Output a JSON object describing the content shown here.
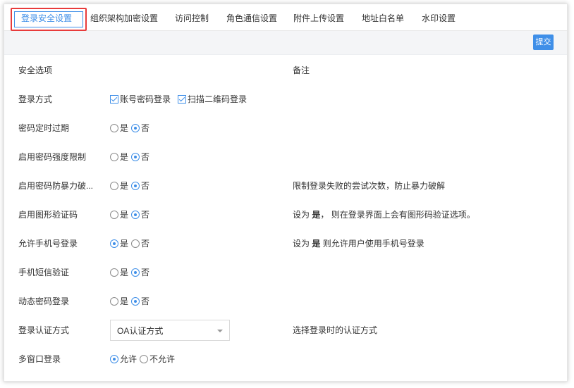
{
  "tabs": [
    {
      "label": "登录安全设置",
      "active": true
    },
    {
      "label": "组织架构加密设置"
    },
    {
      "label": "访问控制"
    },
    {
      "label": "角色通信设置"
    },
    {
      "label": "附件上传设置"
    },
    {
      "label": "地址白名单"
    },
    {
      "label": "水印设置"
    }
  ],
  "toolbar": {
    "submit_label": "提交"
  },
  "header": {
    "options_label": "安全选项",
    "notes_label": "备注"
  },
  "login_methods": {
    "label": "登录方式",
    "options": [
      "账号密码登录",
      "扫描二维码登录"
    ]
  },
  "yes_no": {
    "yes": "是",
    "no": "否"
  },
  "allow_deny": {
    "allow": "允许",
    "deny": "不允许"
  },
  "rows": [
    {
      "label": "密码定时过期",
      "value": "否",
      "note": ""
    },
    {
      "label": "启用密码强度限制",
      "value": "否",
      "note": ""
    },
    {
      "label": "启用密码防暴力破...",
      "value": "否",
      "note": "限制登录失败的尝试次数，防止暴力破解"
    },
    {
      "label": "启用图形验证码",
      "value": "否",
      "note_pre": "设为 ",
      "note_bold": "是",
      "note_post": "， 则在登录界面上会有图形码验证选项。"
    },
    {
      "label": "允许手机号登录",
      "value": "是",
      "note_pre": "设为 ",
      "note_bold": "是",
      "note_post": " 则允许用户使用手机号登录"
    },
    {
      "label": "手机短信验证",
      "value": "否",
      "note": ""
    },
    {
      "label": "动态密码登录",
      "value": "否",
      "note": ""
    }
  ],
  "auth_method": {
    "label": "登录认证方式",
    "value": "OA认证方式",
    "note": "选择登录时的认证方式"
  },
  "multi_window": {
    "label": "多窗口登录",
    "value": "允许"
  },
  "colors": {
    "accent": "#3f8fe8",
    "highlight": "#e83b3b"
  }
}
